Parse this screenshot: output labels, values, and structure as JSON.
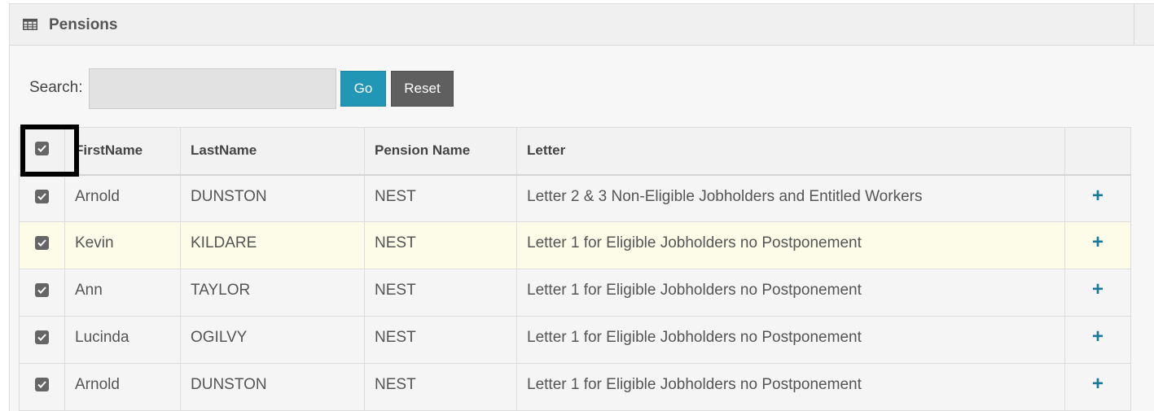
{
  "panel": {
    "title": "Pensions",
    "icon": "table-icon"
  },
  "search": {
    "label": "Search:",
    "value": "",
    "placeholder": "",
    "go_label": "Go",
    "reset_label": "Reset"
  },
  "table": {
    "columns": [
      "FirstName",
      "LastName",
      "Pension Name",
      "Letter"
    ],
    "select_all_checked": true,
    "rows": [
      {
        "checked": true,
        "first": "Arnold",
        "last": "DUNSTON",
        "pension": "NEST",
        "letter": "Letter 2 & 3 Non-Eligible Jobholders and Entitled Workers",
        "action": "+"
      },
      {
        "checked": true,
        "first": "Kevin",
        "last": "KILDARE",
        "pension": "NEST",
        "letter": "Letter 1 for Eligible Jobholders no Postponement",
        "action": "+"
      },
      {
        "checked": true,
        "first": "Ann",
        "last": "TAYLOR",
        "pension": "NEST",
        "letter": "Letter 1 for Eligible Jobholders no Postponement",
        "action": "+"
      },
      {
        "checked": true,
        "first": "Lucinda",
        "last": "OGILVY",
        "pension": "NEST",
        "letter": "Letter 1 for Eligible Jobholders no Postponement",
        "action": "+"
      },
      {
        "checked": true,
        "first": "Arnold",
        "last": "DUNSTON",
        "pension": "NEST",
        "letter": "Letter 1 for Eligible Jobholders no Postponement",
        "action": "+"
      }
    ]
  },
  "colors": {
    "go_button": "#2196b5",
    "reset_button": "#5f5f5f",
    "highlight_row": "#fcfce9",
    "link": "#2a6f9b",
    "plus": "#1a7a9c"
  }
}
